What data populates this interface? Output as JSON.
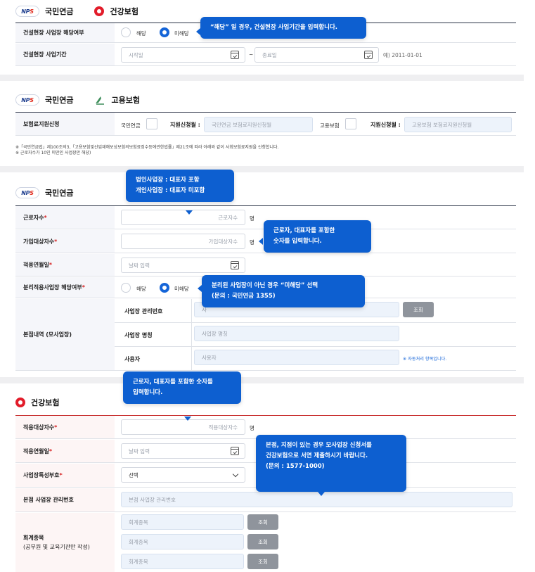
{
  "section1": {
    "logo_nps_main": "NP",
    "logo_nps_tail": "S",
    "title_pension": "국민연금",
    "title_health": "건강보험",
    "row1_label": "건설현장 사업장 해당여부",
    "radio_yes": "해당",
    "radio_no": "미해당",
    "row2_label": "건설현장 사업기간",
    "start_placeholder": "시작일",
    "tilde": "~",
    "end_placeholder": "종료일",
    "example": "예) 2011-01-01",
    "tooltip": "“해당” 일 경우, 건설현장 사업기간을 입력합니다."
  },
  "section2": {
    "title_pension": "국민연금",
    "title_employment": "고용보험",
    "row_label": "보험료지원신청",
    "pension_label": "국민연금",
    "support_label_1": "지원신청월 :",
    "support_placeholder_1": "국민연금 보험료지원신청월",
    "employment_label": "고용보험",
    "support_label_2": "지원신청월 :",
    "support_placeholder_2": "고용보험 보험료지원신청월",
    "note_1": "※「국민연금법」제100조의3,「고용보험및산업재해보상보험의보험료징수등에관한법률」제21조에 따라 아래와 같이 사회보험료지원을 신청합니다.",
    "note_2": "※ 근로자수가 10인 미만인 사업장만 해당)"
  },
  "section3": {
    "title": "국민연금",
    "tooltip_top": [
      "법인사업장 : 대표자 포함",
      "개인사업장 : 대표자 미포함"
    ],
    "workers_label": "근로자수",
    "workers_placeholder": "근로자수",
    "unit": "명",
    "subscribers_label": "가입대상자수",
    "subscribers_placeholder": "가입대상자수",
    "tooltip_side": [
      "근로자, 대표자를 포함한",
      "숫자를 입력합니다."
    ],
    "apply_date_label": "적용연월일",
    "date_placeholder": "날짜 입력",
    "separate_label": "분리적용사업장 해당여부",
    "radio_yes": "해당",
    "radio_no": "미해당",
    "tooltip_separate": [
      "분리된 사업장이 아닌 경우 “미해당” 선택",
      "(문의 : 국민연금 1355)"
    ],
    "hq_label": "본점내역 (모사업장)",
    "mgmt_no_label": "사업장 관리번호",
    "mgmt_no_placeholder": "사",
    "search_button": "조회",
    "biz_name_label": "사업장 명칭",
    "biz_name_placeholder": "사업장 명칭",
    "user_label": "사용자",
    "user_placeholder": "사용자",
    "auto_note": "※ 자동처리 항목입니다."
  },
  "section4": {
    "tooltip_top": [
      "근로자, 대표자를 포함한 숫자를",
      "입력합니다."
    ],
    "title": "건강보험",
    "target_label": "적용대상자수",
    "target_placeholder": "적용대상자수",
    "unit": "명",
    "apply_date_label": "적용연월일",
    "date_placeholder": "날짜 입력",
    "tooltip_hq": [
      "본점, 지점이 있는 경우 모사업장 신청서를",
      "건강보험으로 서면 제출하시기 바랍니다.",
      "(문의 : 1577-1000)"
    ],
    "symbol_label": "사업장특성부호",
    "symbol_value": "선택",
    "hq_mgmt_label": "본점 사업장 관리번호",
    "hq_mgmt_placeholder": "본점 사업장 관리번호",
    "account_label_1": "회계종목",
    "account_label_2": "(공무원 및 교육기관만 작성)",
    "account_placeholders": [
      "회계종목",
      "회계종목",
      "회계종목"
    ],
    "search_button": "조회"
  },
  "colors": {
    "accent": "#0d5fd0",
    "required": "#d61f1f",
    "label_bg": "#f5f6fa",
    "label_bg_health": "#fdf5f5",
    "separator": "#efeff1"
  }
}
